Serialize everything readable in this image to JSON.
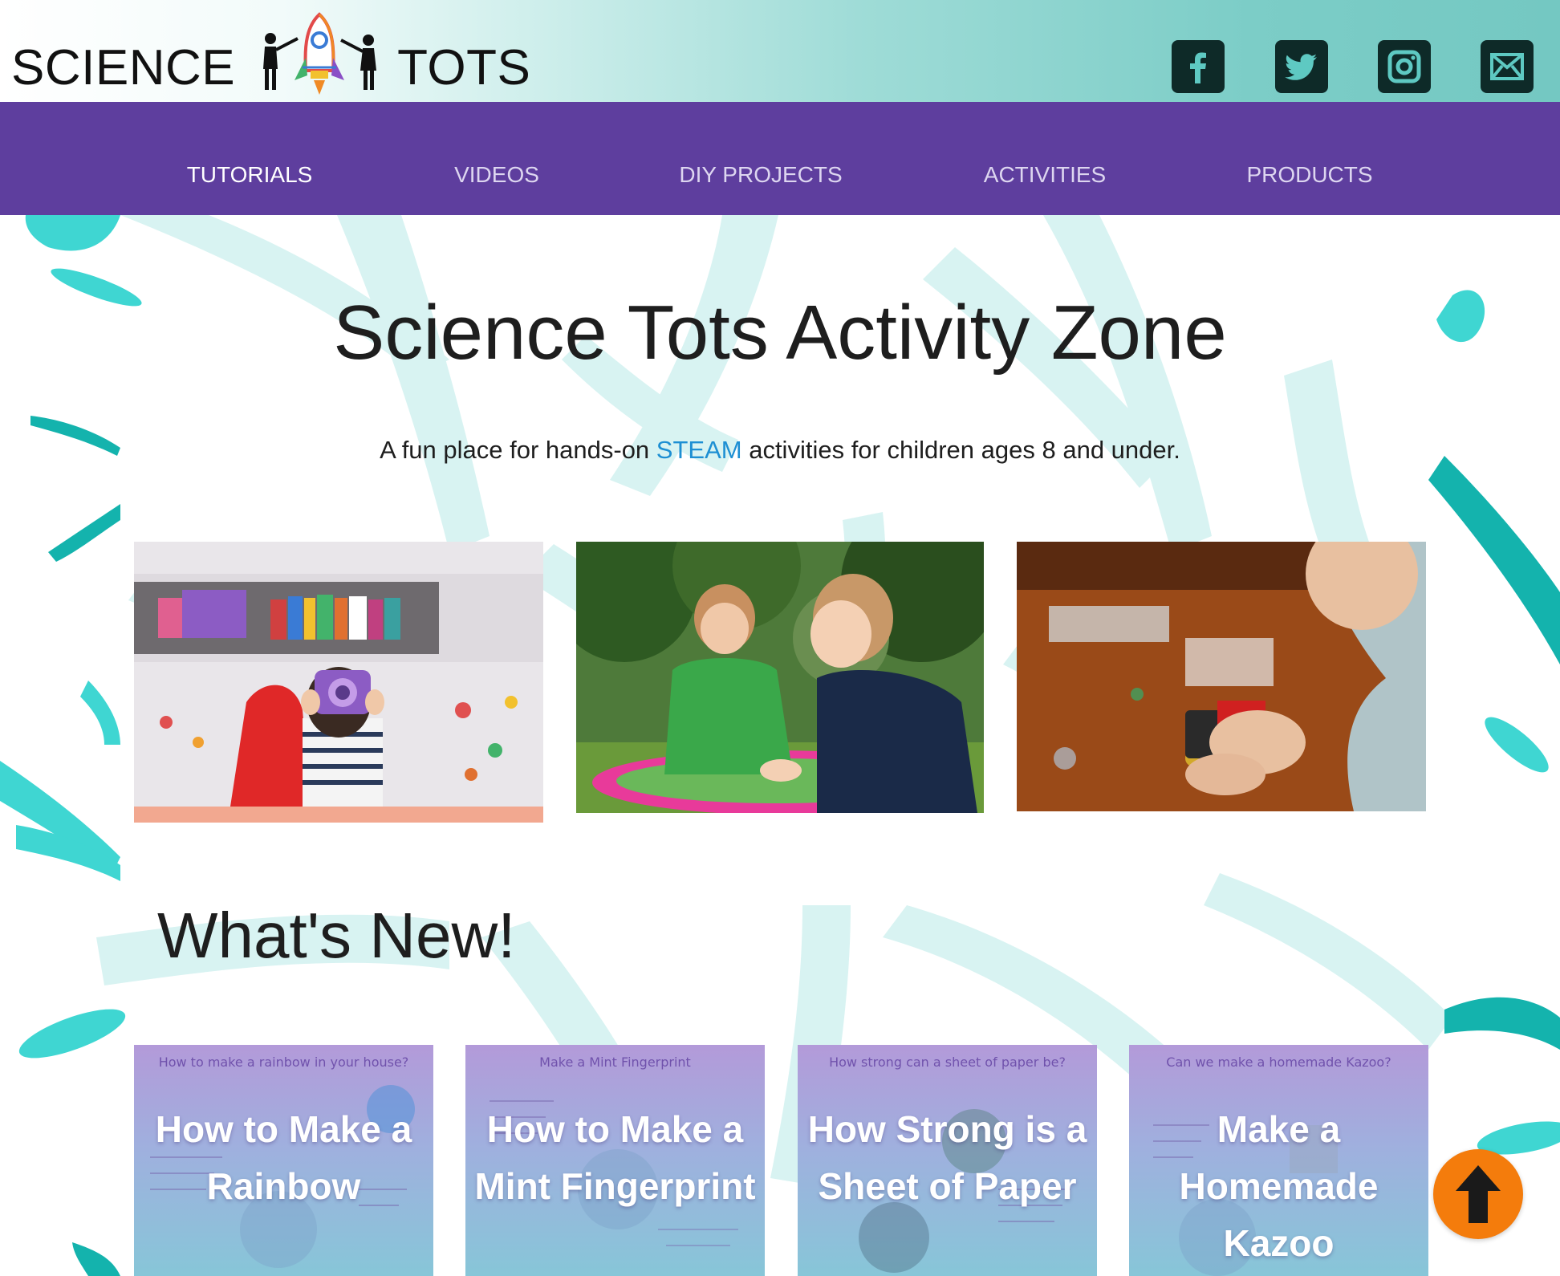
{
  "header": {
    "logo_left": "SCIENCE",
    "logo_right": "TOTS",
    "social": [
      {
        "icon": "facebook-icon"
      },
      {
        "icon": "twitter-icon"
      },
      {
        "icon": "instagram-icon"
      },
      {
        "icon": "email-icon"
      }
    ]
  },
  "nav": {
    "items": [
      {
        "label": "TUTORIALS",
        "active": true
      },
      {
        "label": "VIDEOS",
        "active": false
      },
      {
        "label": "DIY PROJECTS",
        "active": false
      },
      {
        "label": "ACTIVITIES",
        "active": false
      },
      {
        "label": "PRODUCTS",
        "active": false
      }
    ]
  },
  "hero": {
    "title": "Science Tots Activity Zone",
    "tagline_before": "A fun place for hands-on ",
    "tagline_link": "STEAM",
    "tagline_after": " activities for children ages 8 and under."
  },
  "whats_new": {
    "title": "What's New!",
    "cards": [
      {
        "top": "How to make a rainbow in your house?",
        "title": "How to Make a Rainbow"
      },
      {
        "top": "Make a Mint Fingerprint",
        "title": "How to Make a Mint Fingerprint"
      },
      {
        "top": "How strong can a sheet of paper be?",
        "title": "How Strong is a Sheet of Paper"
      },
      {
        "top": "Can we make a homemade Kazoo?",
        "title": "Make a Homemade Kazoo"
      }
    ]
  },
  "colors": {
    "nav_bg": "#5e3e9e",
    "splash": "#3fd6d2",
    "link": "#1d8fd3",
    "to_top": "#f47c0c"
  }
}
